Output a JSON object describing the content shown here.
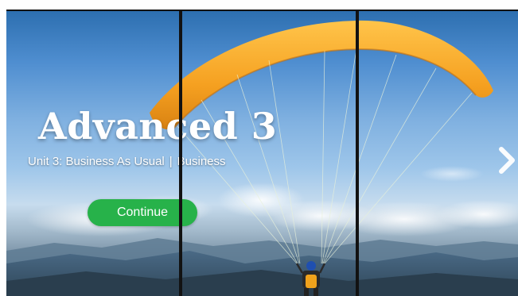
{
  "slide": {
    "title": "Advanced 3",
    "unit": "Unit 3: Business As Usual",
    "separator": "|",
    "category": "Business",
    "continue_label": "Continue",
    "background_image": "paraglider-over-clouds",
    "next_icon": "chevron-right-icon"
  },
  "colors": {
    "button": "#27b24a",
    "text": "#ffffff",
    "wing": "#f5a623",
    "divider": "#121212"
  }
}
